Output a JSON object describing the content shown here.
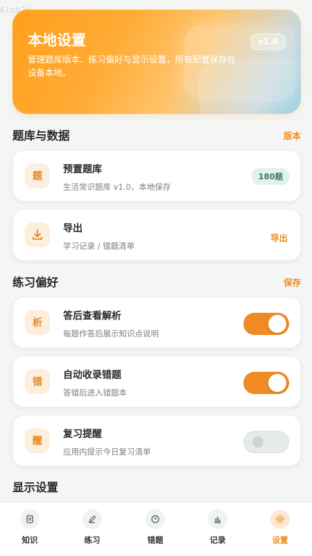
{
  "watermark": "61bb2d",
  "hero": {
    "title": "本地设置",
    "description": "管理题库版本、练习偏好与显示设置，所有配置保存在设备本地。",
    "version": "v1.0"
  },
  "sections": {
    "bank": {
      "title": "题库与数据",
      "action": "版本"
    },
    "prefs": {
      "title": "练习偏好",
      "action": "保存"
    },
    "display": {
      "title": "显示设置"
    }
  },
  "cards": {
    "preset_bank": {
      "icon_text": "题",
      "title": "预置题库",
      "subtitle": "生活常识题库 v1.0，本地保存",
      "badge": "180题"
    },
    "export": {
      "icon": "download-icon",
      "title": "导出",
      "subtitle": "学习记录 / 错题清单",
      "action": "导出"
    },
    "show_analysis": {
      "icon_text": "析",
      "title": "答后查看解析",
      "subtitle": "每题作答后展示知识点说明",
      "enabled": true
    },
    "auto_collect": {
      "icon_text": "错",
      "title": "自动收录错题",
      "subtitle": "答错后进入错题本",
      "enabled": true
    },
    "review_reminder": {
      "icon_text": "醒",
      "title": "复习提醒",
      "subtitle": "应用内提示今日复习清单",
      "enabled": false
    }
  },
  "nav": {
    "items": [
      {
        "label": "知识",
        "icon": "document-icon"
      },
      {
        "label": "练习",
        "icon": "pencil-icon"
      },
      {
        "label": "错题",
        "icon": "clock-icon"
      },
      {
        "label": "记录",
        "icon": "bar-chart-icon"
      },
      {
        "label": "设置",
        "icon": "gear-icon"
      }
    ],
    "active_index": 4
  },
  "colors": {
    "accent": "#ef8a1a",
    "toggle_on": "#f08a24",
    "badge_bg": "#e3f1ec",
    "badge_text": "#3b7d6a"
  }
}
